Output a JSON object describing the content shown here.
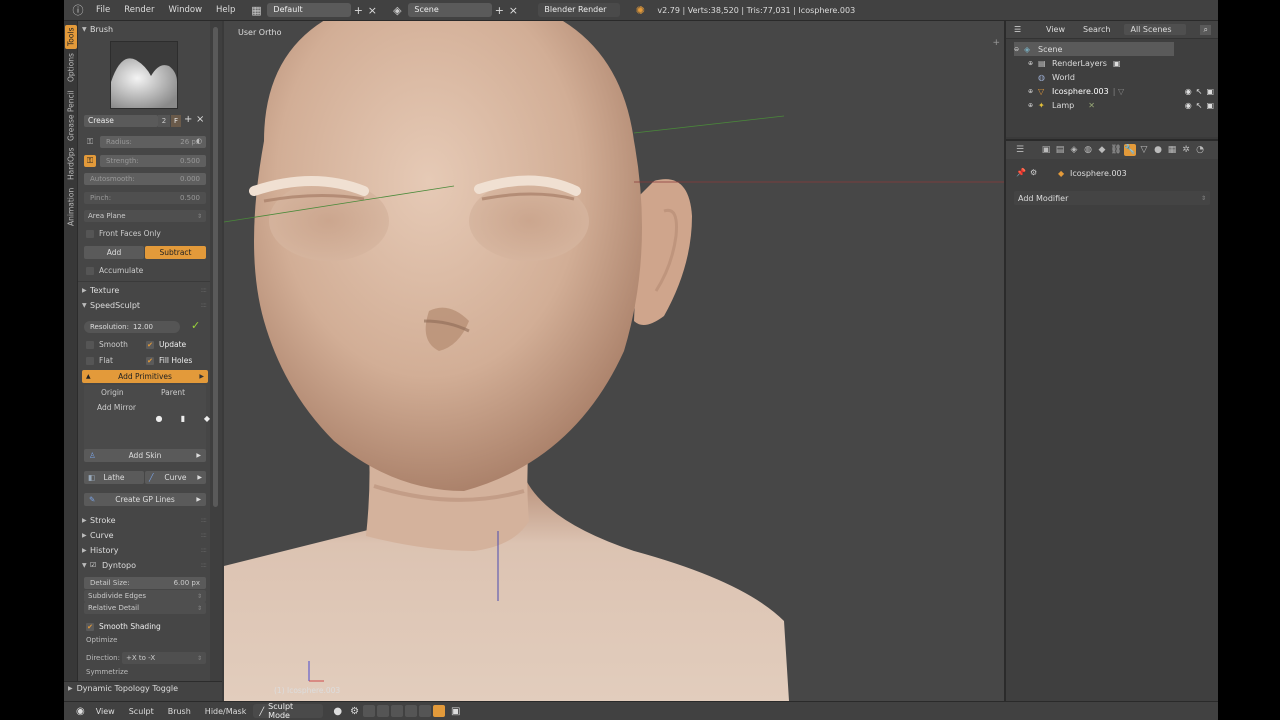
{
  "topbar": {
    "menu": [
      "File",
      "Render",
      "Window",
      "Help"
    ],
    "layout": "Default",
    "scene": "Scene",
    "engine": "Blender Render",
    "stats": "v2.79 | Verts:38,520 | Tris:77,031 | Icosphere.003"
  },
  "tabs": [
    "Tools",
    "Options",
    "Grease Pencil",
    "HardOps",
    "Animation"
  ],
  "shelf": {
    "brush_panel": "Brush",
    "brush_name": "Crease",
    "brush_users": "2",
    "brush_fake": "F",
    "radius_label": "Radius:",
    "radius_value": "26 px",
    "strength_label": "Strength:",
    "strength_value": "0.500",
    "autosmooth_label": "Autosmooth:",
    "autosmooth_value": "0.000",
    "pinch_label": "Pinch:",
    "pinch_value": "0.500",
    "area_plane": "Area Plane",
    "front_faces": "Front Faces Only",
    "add": "Add",
    "subtract": "Subtract",
    "accumulate": "Accumulate",
    "texture_panel": "Texture",
    "speedsculpt_panel": "SpeedSculpt",
    "resolution_label": "Resolution:",
    "resolution_value": "12.00",
    "smooth": "Smooth",
    "update": "Update",
    "flat": "Flat",
    "fill_holes": "Fill Holes",
    "add_primitives": "Add Primitives",
    "origin": "Origin",
    "parent": "Parent",
    "add_mirror": "Add Mirror",
    "add_skin": "Add Skin",
    "lathe": "Lathe",
    "curve_btn": "Curve",
    "create_gp_lines": "Create GP Lines",
    "stroke_panel": "Stroke",
    "curve_panel": "Curve",
    "history_panel": "History",
    "dyntopo_panel": "Dyntopo",
    "detail_size_label": "Detail Size:",
    "detail_size_value": "6.00 px",
    "subdivide_edges": "Subdivide Edges",
    "relative_detail": "Relative Detail",
    "smooth_shading": "Smooth Shading",
    "optimize": "Optimize",
    "direction_label": "Direction:",
    "direction_value": "+X to -X",
    "symmetrize": "Symmetrize",
    "dyntopo_toggle": "Dynamic Topology Toggle"
  },
  "viewport": {
    "view_name": "User Ortho",
    "object_label": "(1) Icosphere.003"
  },
  "bottombar": {
    "items": [
      "View",
      "Sculpt",
      "Brush",
      "Hide/Mask"
    ],
    "mode": "Sculpt Mode"
  },
  "outliner": {
    "menu": [
      "View",
      "Search"
    ],
    "filter": "All Scenes",
    "rows": [
      "Scene",
      "RenderLayers",
      "World",
      "Icosphere.003",
      "Lamp"
    ]
  },
  "properties": {
    "object": "Icosphere.003",
    "add_modifier": "Add Modifier"
  },
  "colors": {
    "accent": "#e39a3a",
    "skin": "#d8b49c",
    "background": "#474747"
  }
}
